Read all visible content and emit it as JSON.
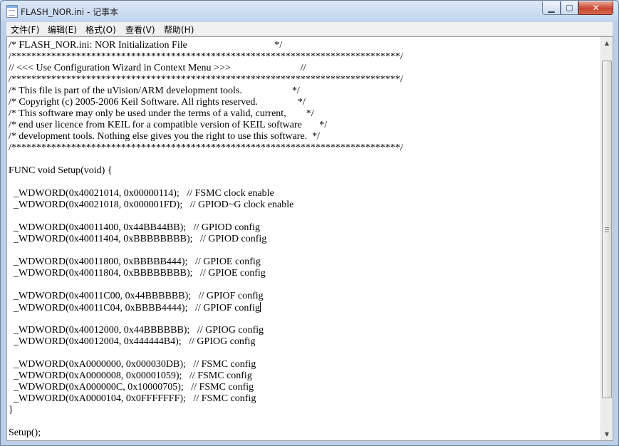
{
  "window": {
    "title": "FLASH_NOR.ini - 记事本",
    "icon": "notepad-icon",
    "controls": {
      "minimize_glyph": "▁",
      "maximize_glyph": "▢",
      "close_glyph": "✕"
    }
  },
  "menu": {
    "items": [
      "文件(F)",
      "编辑(E)",
      "格式(O)",
      "查看(V)",
      "帮助(H)"
    ]
  },
  "editor": {
    "lines": [
      "/* FLASH_NOR.ini: NOR Initialization File                                   */",
      "/******************************************************************************/",
      "// <<< Use Configuration Wizard in Context Menu >>>                            //",
      "/******************************************************************************/",
      "/* This file is part of the uVision/ARM development tools.                    */",
      "/* Copyright (c) 2005-2006 Keil Software. All rights reserved.                */",
      "/* This software may only be used under the terms of a valid, current,        */",
      "/* end user licence from KEIL for a compatible version of KEIL software       */",
      "/* development tools. Nothing else gives you the right to use this software.  */",
      "/******************************************************************************/",
      "",
      "FUNC void Setup(void) {",
      "",
      "  _WDWORD(0x40021014, 0x00000114);   // FSMC clock enable",
      "  _WDWORD(0x40021018, 0x000001FD);   // GPIOD~G clock enable",
      "",
      "  _WDWORD(0x40011400, 0x44BB44BB);   // GPIOD config",
      "  _WDWORD(0x40011404, 0xBBBBBBBB);   // GPIOD config",
      "",
      "  _WDWORD(0x40011800, 0xBBBBB444);   // GPIOE config",
      "  _WDWORD(0x40011804, 0xBBBBBBBB);   // GPIOE config",
      "",
      "  _WDWORD(0x40011C00, 0x44BBBBBB);   // GPIOF config",
      "  _WDWORD(0x40011C04, 0xBBBB4444);   // GPIOF config",
      "",
      "  _WDWORD(0x40012000, 0x44BBBBBB);   // GPIOG config",
      "  _WDWORD(0x40012004, 0x444444B4);   // GPIOG config",
      "",
      "  _WDWORD(0xA0000000, 0x000030DB);   // FSMC config",
      "  _WDWORD(0xA0000008, 0x00001059);   // FSMC config",
      "  _WDWORD(0xA000000C, 0x10000705);   // FSMC config",
      "  _WDWORD(0xA0000104, 0x0FFFFFFF);   // FSMC config",
      "}",
      "",
      "Setup();"
    ],
    "caret_line_index": 23
  },
  "scrollbar": {
    "up_glyph": "▲",
    "down_glyph": "▼"
  }
}
